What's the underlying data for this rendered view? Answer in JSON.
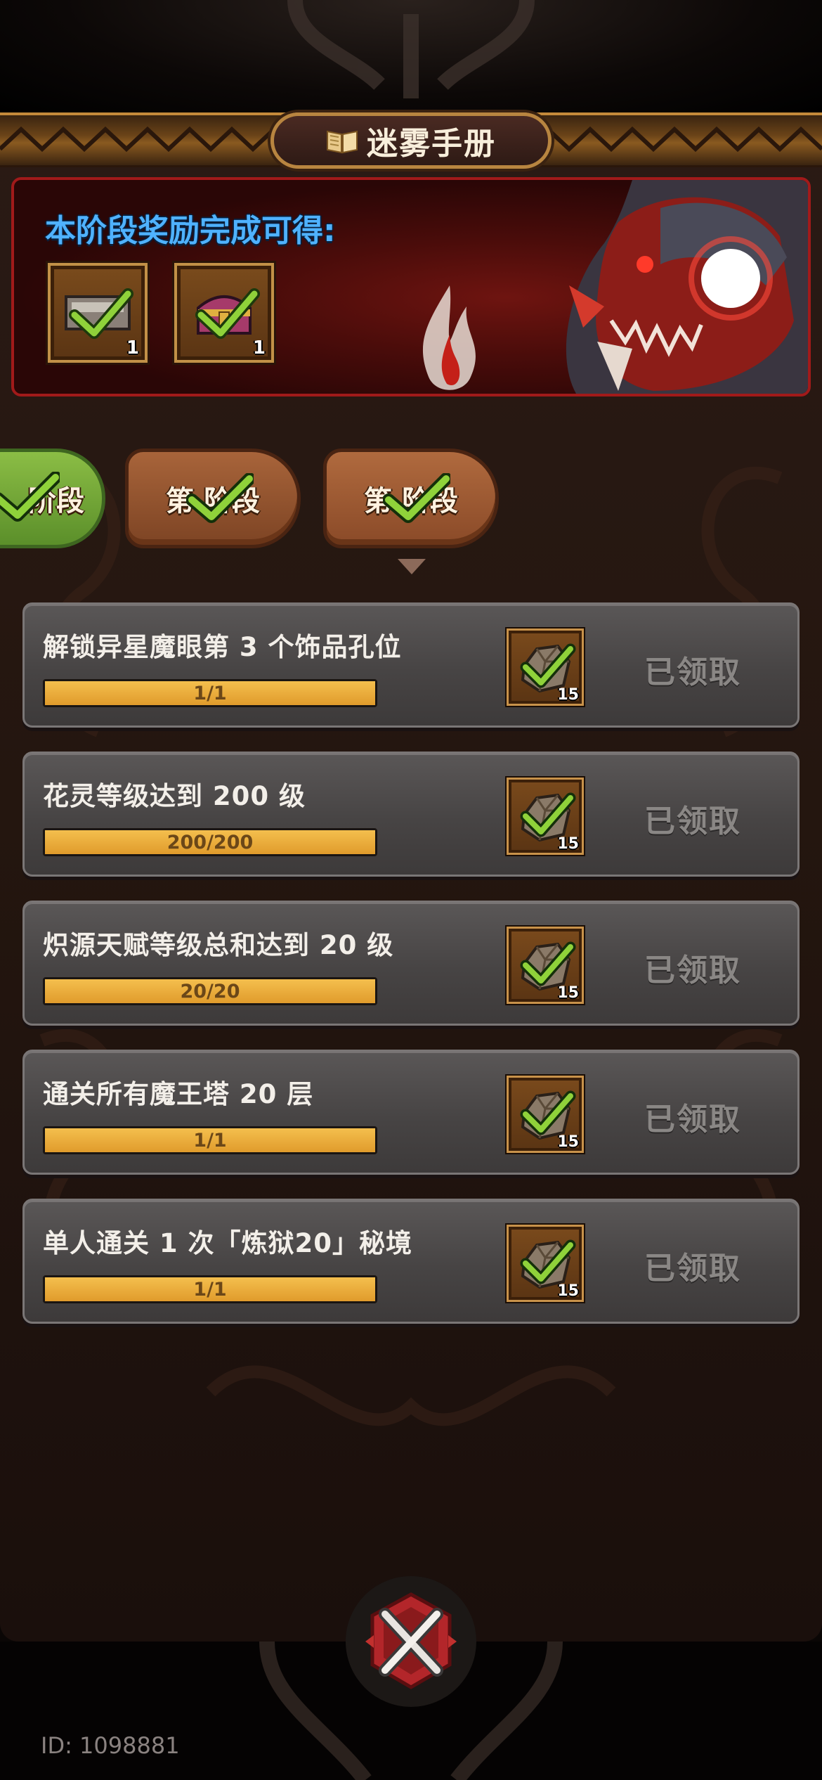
{
  "header": {
    "title": "迷雾手册",
    "icon": "book-icon"
  },
  "banner": {
    "title": "本阶段奖励完成可得:",
    "rewards": [
      {
        "icon": "weapon-chest-icon",
        "count": "1"
      },
      {
        "icon": "treasure-chest-icon",
        "count": "1"
      }
    ]
  },
  "stage_tabs": [
    {
      "label": "阶段",
      "state": "completed"
    },
    {
      "label": "第 阶段",
      "state": "completed"
    },
    {
      "label": "第 阶段",
      "state": "completed-selected"
    }
  ],
  "tasks": [
    {
      "title": "解锁异星魔眼第 3 个饰品孔位",
      "progress": "1/1",
      "progress_fraction": 1.0,
      "reward_icon": "ore-icon",
      "reward_count": "15",
      "status": "已领取"
    },
    {
      "title": "花灵等级达到 200 级",
      "progress": "200/200",
      "progress_fraction": 1.0,
      "reward_icon": "ore-icon",
      "reward_count": "15",
      "status": "已领取"
    },
    {
      "title": "炽源天赋等级总和达到 20 级",
      "progress": "20/20",
      "progress_fraction": 1.0,
      "reward_icon": "ore-icon",
      "reward_count": "15",
      "status": "已领取"
    },
    {
      "title": "通关所有魔王塔 20 层",
      "progress": "1/1",
      "progress_fraction": 1.0,
      "reward_icon": "ore-icon",
      "reward_count": "15",
      "status": "已领取"
    },
    {
      "title": "单人通关 1 次「炼狱20」秘境",
      "progress": "1/1",
      "progress_fraction": 1.0,
      "reward_icon": "ore-icon",
      "reward_count": "15",
      "status": "已领取"
    }
  ],
  "footer": {
    "user_id": "ID: 1098881"
  },
  "colors": {
    "accent_blue": "#4fb2ff",
    "progress_orange": "#eaa93a",
    "check_green": "#8fd23a",
    "banner_red": "#a11a1a"
  }
}
